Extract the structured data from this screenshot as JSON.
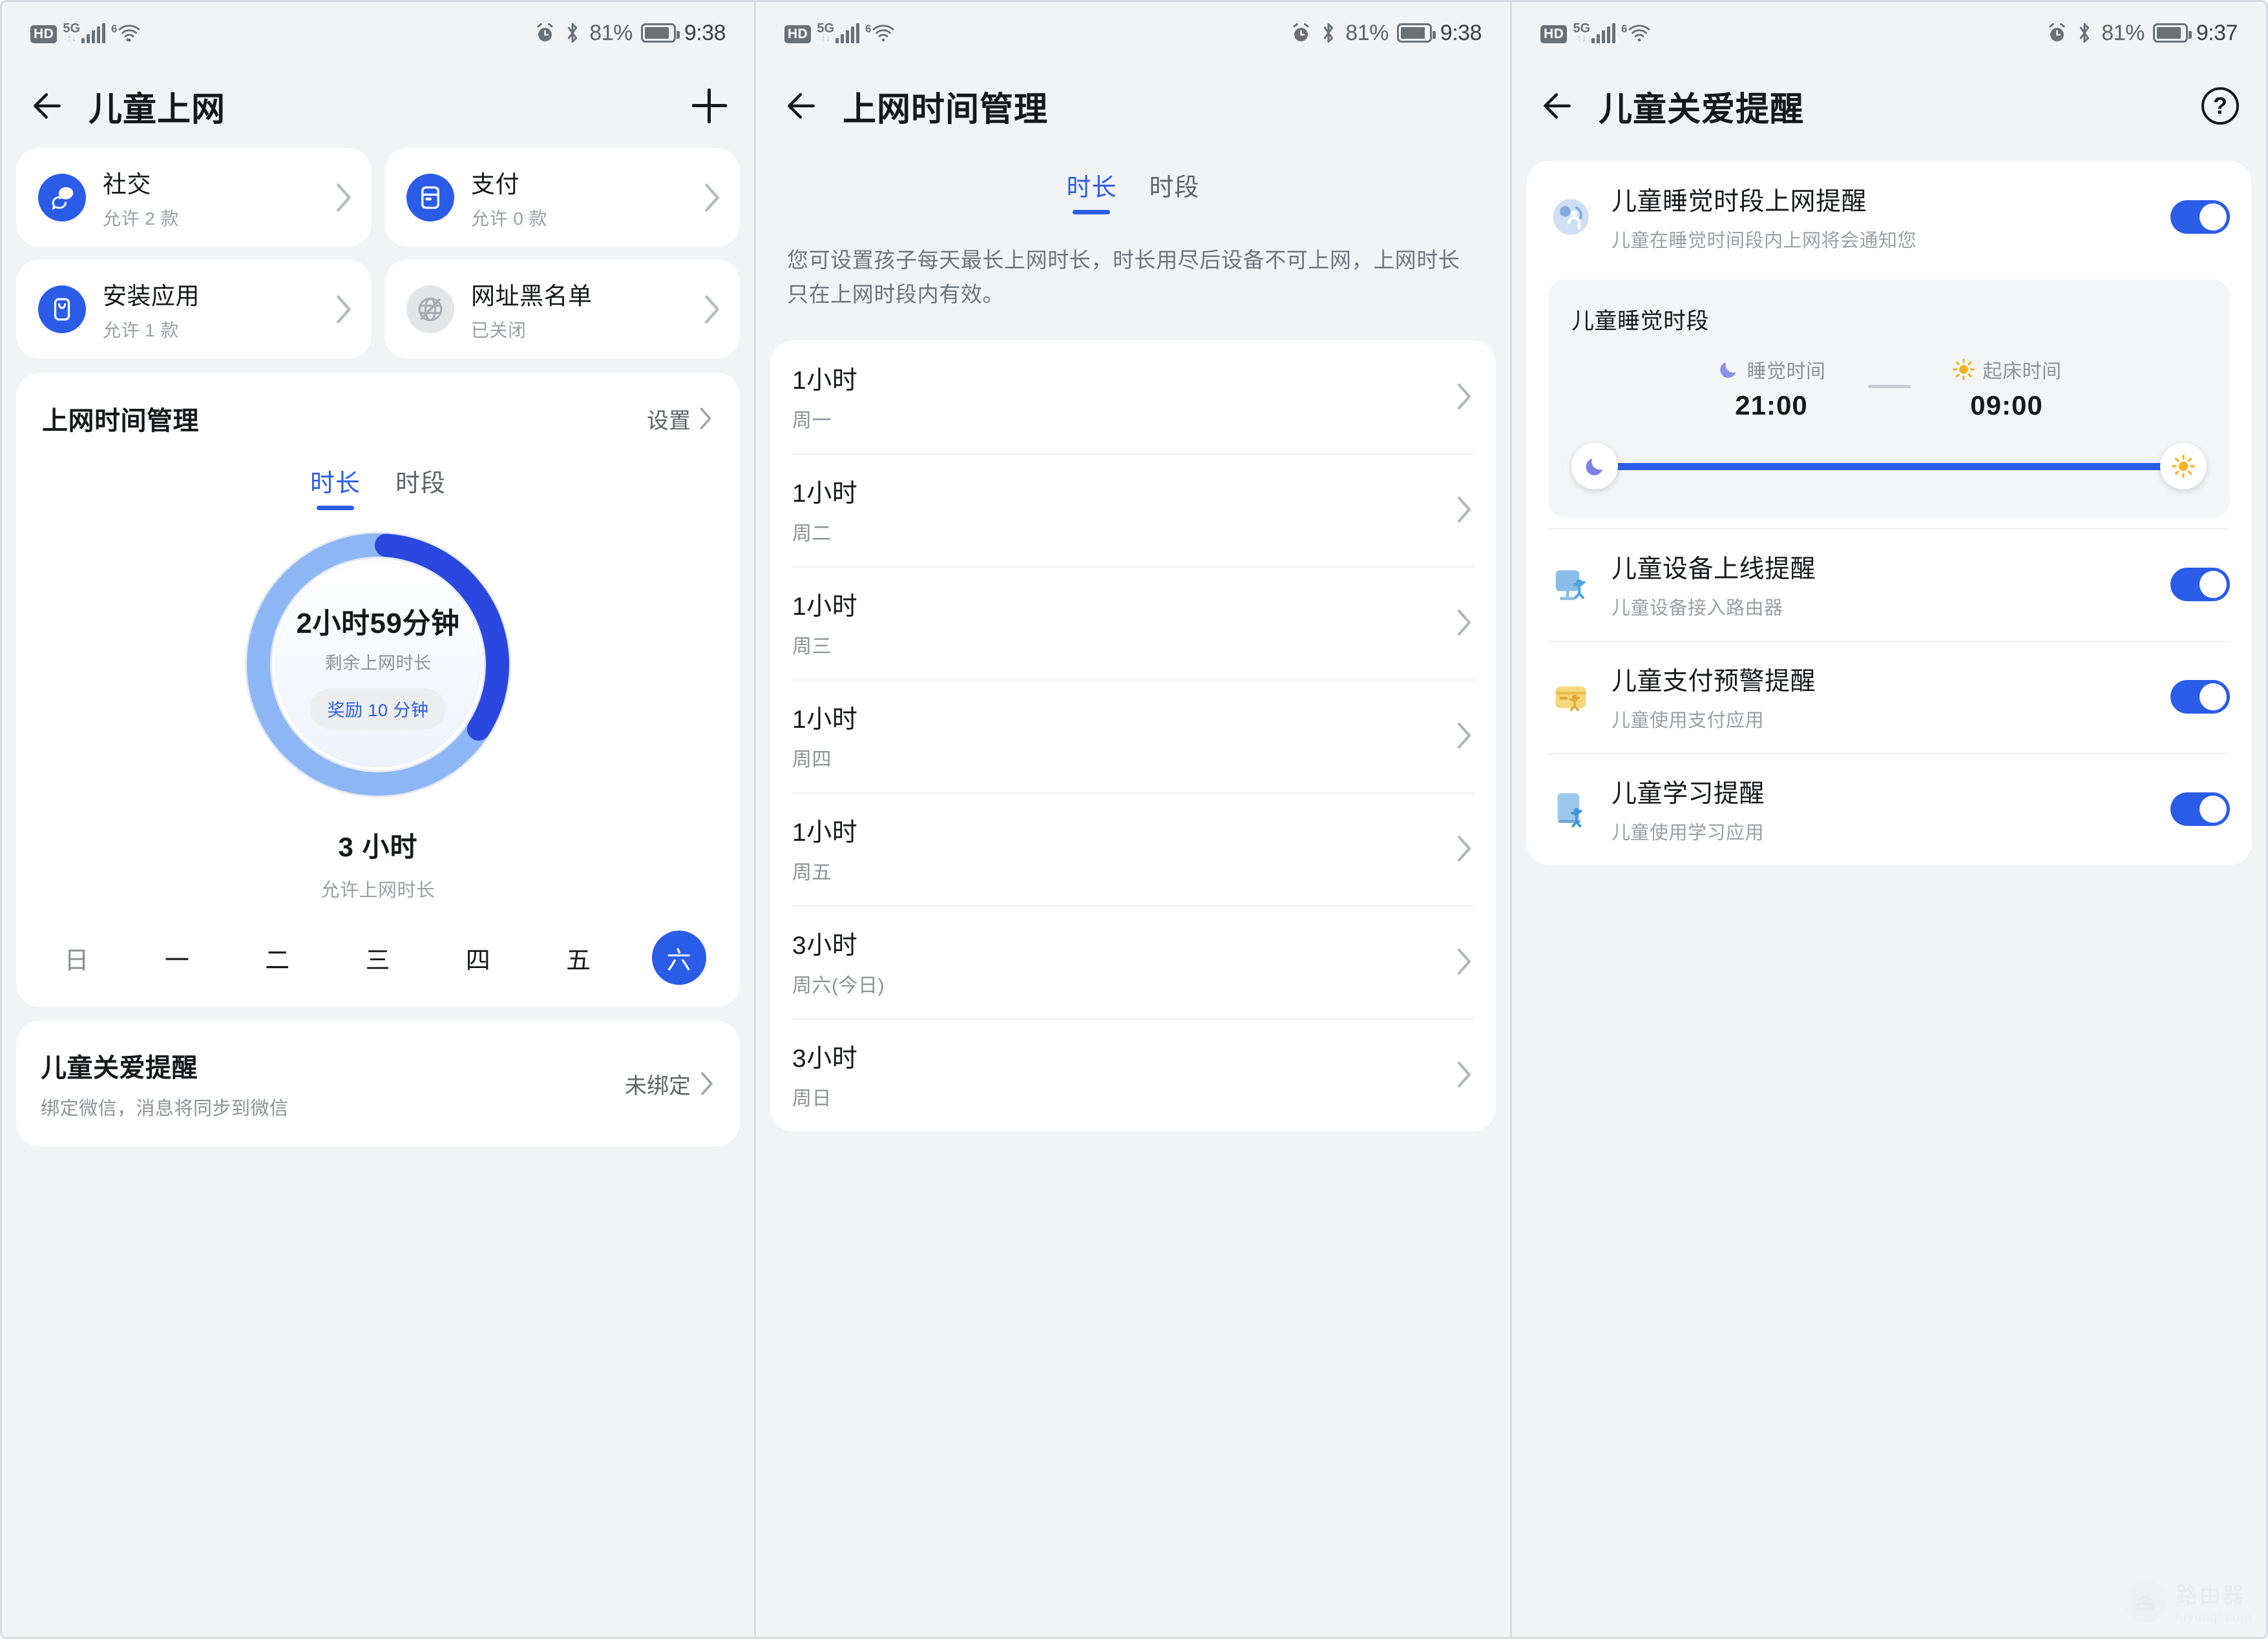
{
  "statusbar": {
    "hd_badge": "HD",
    "network_label": "5G",
    "wifi_label": "6",
    "battery_pct": "81%",
    "time_screen1": "9:38",
    "time_screen2": "9:38",
    "time_screen3": "9:37"
  },
  "screen1": {
    "title": "儿童上网",
    "add_button": "+",
    "tiles": [
      {
        "label": "社交",
        "sub": "允许 2 款",
        "icon": "chat-bubble-icon",
        "icon_state": "blue"
      },
      {
        "label": "支付",
        "sub": "允许 0 款",
        "icon": "card-icon",
        "icon_state": "blue"
      },
      {
        "label": "安装应用",
        "sub": "允许 1 款",
        "icon": "app-install-icon",
        "icon_state": "blue"
      },
      {
        "label": "网址黑名单",
        "sub": "已关闭",
        "icon": "globe-blocked-icon",
        "icon_state": "grey"
      }
    ],
    "time_card": {
      "title": "上网时间管理",
      "settings_link": "设置",
      "tabs": [
        {
          "label": "时长",
          "active": true
        },
        {
          "label": "时段",
          "active": false
        }
      ],
      "gauge": {
        "value_text": "2小时59分钟",
        "value_caption": "剩余上网时长",
        "reward_button": "奖励 10 分钟",
        "progress_pct": 33,
        "track_color": "#8db6f5",
        "progress_color": "#2a48e0"
      },
      "allowed_value": "3 小时",
      "allowed_caption": "允许上网时长",
      "days": [
        {
          "label": "日",
          "state": "muted"
        },
        {
          "label": "一",
          "state": "normal"
        },
        {
          "label": "二",
          "state": "normal"
        },
        {
          "label": "三",
          "state": "normal"
        },
        {
          "label": "四",
          "state": "normal"
        },
        {
          "label": "五",
          "state": "normal"
        },
        {
          "label": "六",
          "state": "selected"
        }
      ]
    },
    "care_card": {
      "title": "儿童关爱提醒",
      "subtitle": "绑定微信，消息将同步到微信",
      "status": "未绑定"
    }
  },
  "screen2": {
    "title": "上网时间管理",
    "tabs": [
      {
        "label": "时长",
        "active": true
      },
      {
        "label": "时段",
        "active": false
      }
    ],
    "description": "您可设置孩子每天最长上网时长，时长用尽后设备不可上网，上网时长只在上网时段内有效。",
    "rows": [
      {
        "value": "1小时",
        "day": "周一"
      },
      {
        "value": "1小时",
        "day": "周二"
      },
      {
        "value": "1小时",
        "day": "周三"
      },
      {
        "value": "1小时",
        "day": "周四"
      },
      {
        "value": "1小时",
        "day": "周五"
      },
      {
        "value": "3小时",
        "day": "周六(今日)"
      },
      {
        "value": "3小时",
        "day": "周日"
      }
    ]
  },
  "screen3": {
    "title": "儿童关爱提醒",
    "help_button": "?",
    "sleep_reminder": {
      "title": "儿童睡觉时段上网提醒",
      "subtitle": "儿童在睡觉时间段内上网将会通知您",
      "toggle_on": true,
      "icon": "globe-kid-icon"
    },
    "sleep_box": {
      "title": "儿童睡觉时段",
      "bed_label": "睡觉时间",
      "bed_time": "21:00",
      "wake_label": "起床时间",
      "wake_time": "09:00",
      "moon_icon": "moon-icon",
      "sun_icon": "sun-icon"
    },
    "rows": [
      {
        "title": "儿童设备上线提醒",
        "subtitle": "儿童设备接入路由器",
        "toggle_on": true,
        "icon": "monitor-kid-icon"
      },
      {
        "title": "儿童支付预警提醒",
        "subtitle": "儿童使用支付应用",
        "toggle_on": true,
        "icon": "wallet-kid-icon"
      },
      {
        "title": "儿童学习提醒",
        "subtitle": "儿童使用学习应用",
        "toggle_on": true,
        "icon": "book-kid-icon"
      }
    ]
  },
  "watermark": {
    "name": "路由器",
    "domain": "luyouqi.com"
  },
  "colors": {
    "accent": "#2a5ce8",
    "track": "#8db6f5",
    "progress": "#2a48e0",
    "bg": "#f1f3f5"
  }
}
